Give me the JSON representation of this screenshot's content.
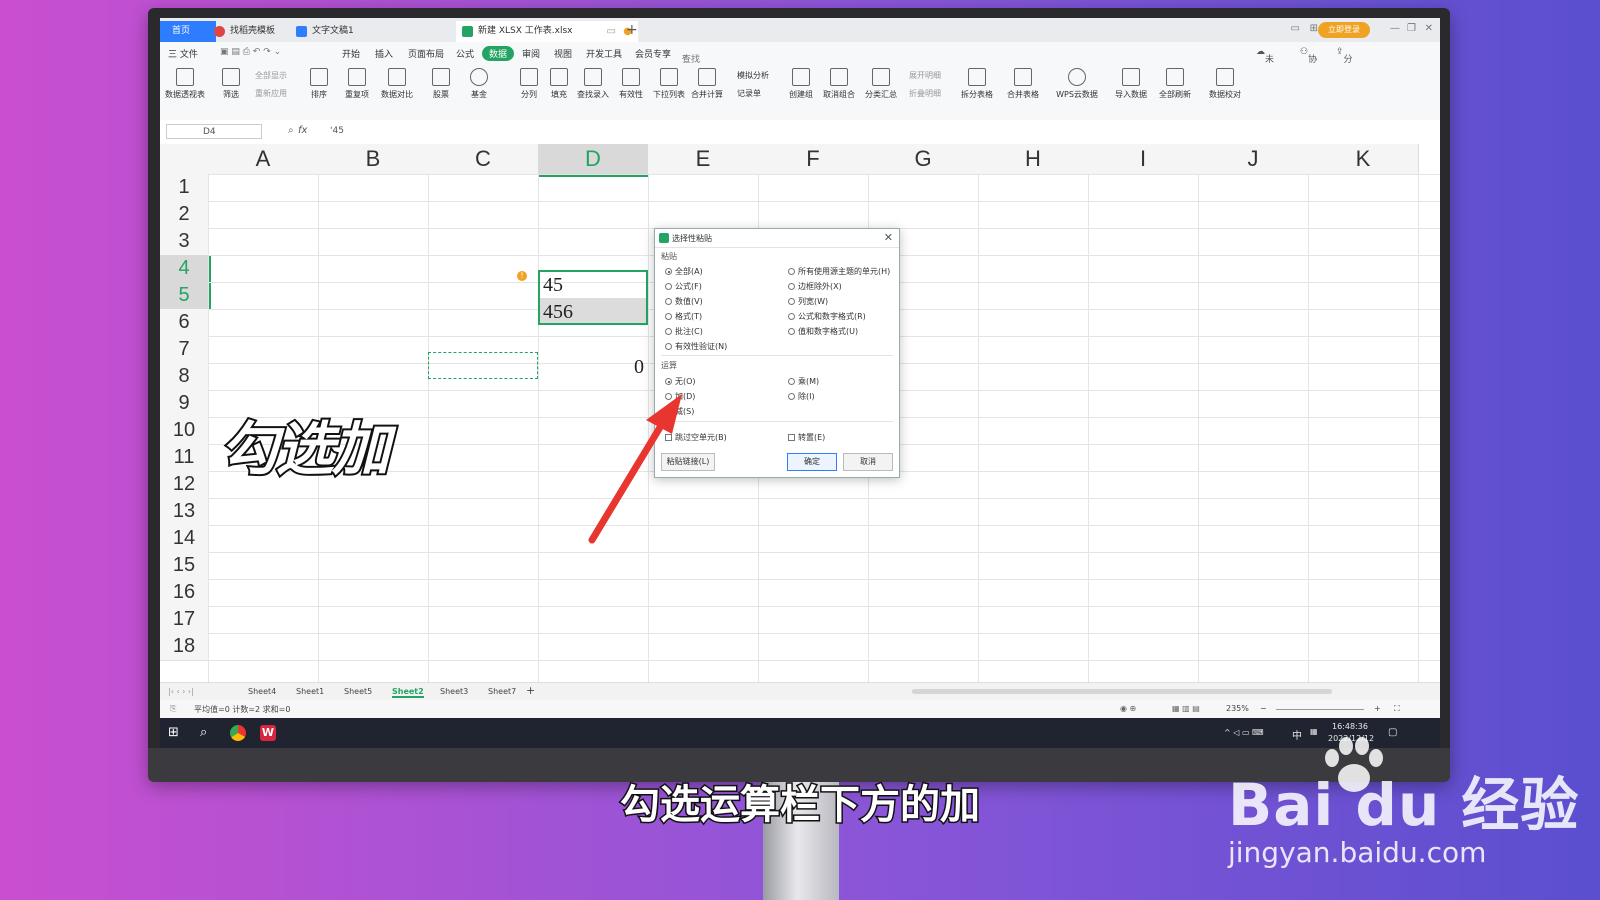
{
  "tabs": [
    {
      "label": "首页"
    },
    {
      "label": "找稻壳模板"
    },
    {
      "label": "文字文稿1"
    },
    {
      "label": "新建 XLSX 工作表.xlsx"
    }
  ],
  "login_label": "立即登录",
  "menu": [
    "三 文件",
    "开始",
    "插入",
    "页面布局",
    "公式",
    "数据",
    "审阅",
    "视图",
    "开发工具",
    "会员专享",
    "查找命令、搜索模板"
  ],
  "menu_right": [
    "未同步",
    "协作",
    "分享"
  ],
  "ribbon": [
    "数据透视表",
    "筛选",
    "排序",
    "重复项",
    "数据对比",
    "股票",
    "基金",
    "分列",
    "填充",
    "查找录入",
    "有效性",
    "下拉列表",
    "合并计算",
    "记录单",
    "创建组",
    "取消组合",
    "分类汇总",
    "拆分表格",
    "合并表格",
    "WPS云数据",
    "导入数据",
    "全部刷新",
    "数据校对"
  ],
  "ribbon_small": [
    "全部显示",
    "重新应用",
    "模拟分析",
    "展开明细",
    "折叠明细"
  ],
  "namebox": "D4",
  "formula": "'45",
  "columns": [
    "A",
    "B",
    "C",
    "D",
    "E",
    "F",
    "G",
    "H",
    "I",
    "J",
    "K"
  ],
  "rows": [
    "1",
    "2",
    "3",
    "4",
    "5",
    "6",
    "7",
    "8",
    "9",
    "10",
    "11",
    "12",
    "13",
    "14",
    "15",
    "16",
    "17",
    "18"
  ],
  "cells": {
    "d4": "45",
    "d5": "456",
    "d7": "0"
  },
  "dialog": {
    "title": "选择性粘贴",
    "paste_group": "粘贴",
    "paste_left": [
      "全部(A)",
      "公式(F)",
      "数值(V)",
      "格式(T)",
      "批注(C)",
      "有效性验证(N)"
    ],
    "paste_right": [
      "所有使用源主题的单元(H)",
      "边框除外(X)",
      "列宽(W)",
      "公式和数字格式(R)",
      "值和数字格式(U)"
    ],
    "op_group": "运算",
    "op_left": [
      "无(O)",
      "加(D)",
      "减(S)"
    ],
    "op_right": [
      "乘(M)",
      "除(I)"
    ],
    "skip_blanks": "跳过空单元(B)",
    "transpose": "转置(E)",
    "paste_link": "粘贴链接(L)",
    "ok": "确定",
    "cancel": "取消"
  },
  "sheets": [
    "Sheet4",
    "Sheet1",
    "Sheet5",
    "Sheet2",
    "Sheet3",
    "Sheet7"
  ],
  "active_sheet": "Sheet2",
  "status_left": "平均值=0  计数=2  求和=0",
  "zoom": "235%",
  "clock_time": "16:48:36",
  "clock_date": "2022/12/12",
  "ime": "中",
  "overlay_caption": "勾选加",
  "subtitle": "勾选运算栏下方的加",
  "watermark": {
    "logo": "Bai du 经验",
    "url": "jingyan.baidu.com"
  },
  "colors": {
    "accent": "#23a463",
    "tab_blue": "#2f7dff",
    "arrow": "#e8352f"
  }
}
